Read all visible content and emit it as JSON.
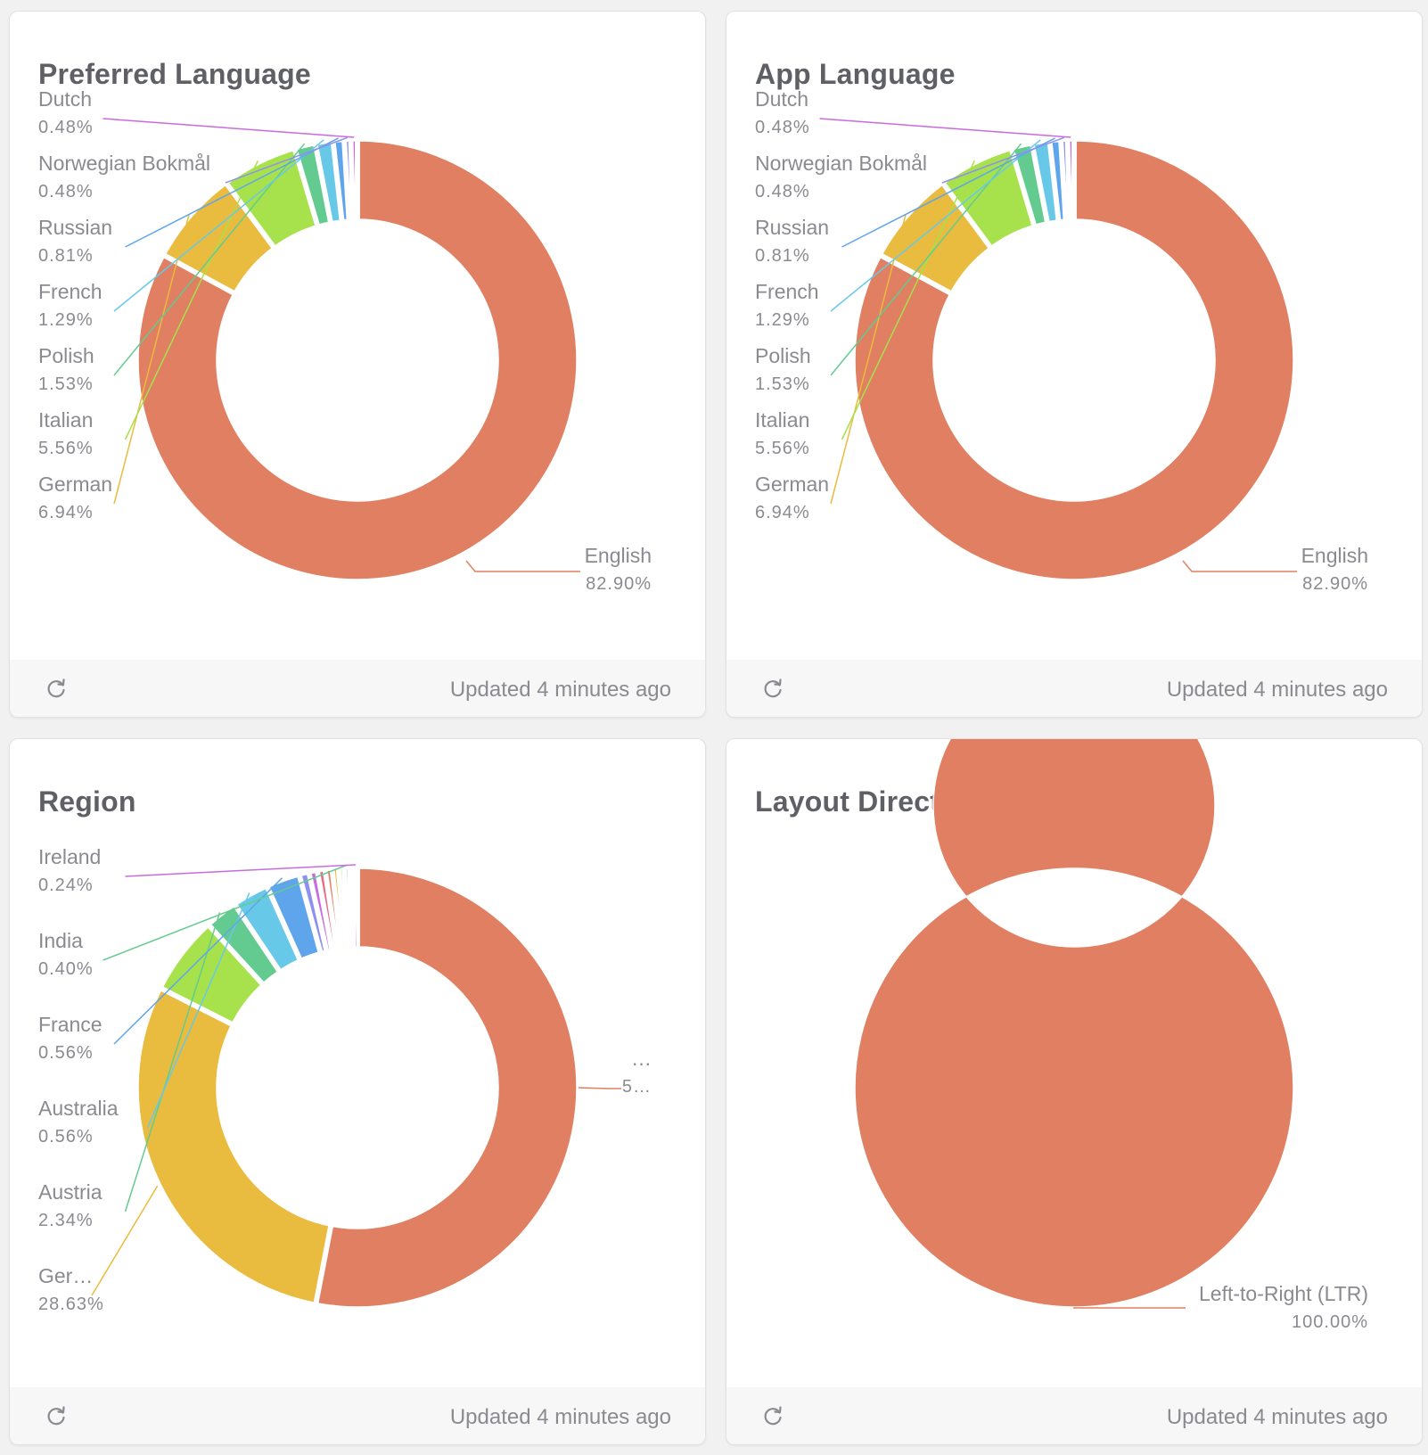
{
  "cards": [
    {
      "title": "Preferred Language",
      "updated": "Updated 4 minutes ago",
      "refresh_icon": "refresh-icon"
    },
    {
      "title": "App Language",
      "updated": "Updated 4 minutes ago",
      "refresh_icon": "refresh-icon"
    },
    {
      "title": "Region",
      "updated": "Updated 4 minutes ago",
      "refresh_icon": "refresh-icon"
    },
    {
      "title": "Layout Direction",
      "updated": "Updated 4 minutes ago",
      "refresh_icon": "refresh-icon"
    }
  ],
  "chart_data": [
    {
      "type": "pie",
      "donut": true,
      "title": "Preferred Language",
      "slices": [
        {
          "label": "English",
          "value_text": "82.90%",
          "value": 82.9,
          "color": "#e07f61"
        },
        {
          "label": "German",
          "value_text": "6.94%",
          "value": 6.94,
          "color": "#e9bb3e"
        },
        {
          "label": "Italian",
          "value_text": "5.56%",
          "value": 5.56,
          "color": "#a7e14c"
        },
        {
          "label": "Polish",
          "value_text": "1.53%",
          "value": 1.53,
          "color": "#64cb90"
        },
        {
          "label": "French",
          "value_text": "1.29%",
          "value": 1.29,
          "color": "#67c9e7"
        },
        {
          "label": "Russian",
          "value_text": "0.81%",
          "value": 0.81,
          "color": "#5fa5eb"
        },
        {
          "label": "Norwegian Bokmål",
          "value_text": "0.48%",
          "value": 0.48,
          "color": "#8f8ff0"
        },
        {
          "label": "Dutch",
          "value_text": "0.48%",
          "value": 0.48,
          "color": "#c86be0"
        }
      ]
    },
    {
      "type": "pie",
      "donut": true,
      "title": "App Language",
      "slices": [
        {
          "label": "English",
          "value_text": "82.90%",
          "value": 82.9,
          "color": "#e07f61"
        },
        {
          "label": "German",
          "value_text": "6.94%",
          "value": 6.94,
          "color": "#e9bb3e"
        },
        {
          "label": "Italian",
          "value_text": "5.56%",
          "value": 5.56,
          "color": "#a7e14c"
        },
        {
          "label": "Polish",
          "value_text": "1.53%",
          "value": 1.53,
          "color": "#64cb90"
        },
        {
          "label": "French",
          "value_text": "1.29%",
          "value": 1.29,
          "color": "#67c9e7"
        },
        {
          "label": "Russian",
          "value_text": "0.81%",
          "value": 0.81,
          "color": "#5fa5eb"
        },
        {
          "label": "Norwegian Bokmål",
          "value_text": "0.48%",
          "value": 0.48,
          "color": "#8f8ff0"
        },
        {
          "label": "Dutch",
          "value_text": "0.48%",
          "value": 0.48,
          "color": "#c86be0"
        }
      ]
    },
    {
      "type": "pie",
      "donut": true,
      "title": "Region",
      "slices": [
        {
          "label": "…",
          "value_text": "5…",
          "value": 51.6,
          "color": "#e07f61"
        },
        {
          "label": "Ger…",
          "value_text": "28.63%",
          "value": 28.63,
          "color": "#e9bb3e"
        },
        {
          "label": "",
          "value_text": "",
          "value": 5.6,
          "color": "#a7e14c"
        },
        {
          "label": "Austria",
          "value_text": "2.34%",
          "value": 2.34,
          "color": "#64cb90"
        },
        {
          "label": "Australia",
          "value_text": "0.56%",
          "value": 2.6,
          "color": "#67c9e7"
        },
        {
          "label": "France",
          "value_text": "0.56%",
          "value": 2.4,
          "color": "#5fa5eb"
        },
        {
          "label": "",
          "value_text": "",
          "value": 0.7,
          "color": "#8f8ff0"
        },
        {
          "label": "",
          "value_text": "",
          "value": 0.6,
          "color": "#c86be0"
        },
        {
          "label": "",
          "value_text": "",
          "value": 0.55,
          "color": "#e56b86"
        },
        {
          "label": "",
          "value_text": "",
          "value": 0.5,
          "color": "#e07f61"
        },
        {
          "label": "",
          "value_text": "",
          "value": 0.45,
          "color": "#e9bb3e"
        },
        {
          "label": "",
          "value_text": "",
          "value": 0.4,
          "color": "#a7e14c"
        },
        {
          "label": "India",
          "value_text": "0.40%",
          "value": 0.4,
          "color": "#64cb90"
        },
        {
          "label": "",
          "value_text": "",
          "value": 0.3,
          "color": "#67c9e7"
        },
        {
          "label": "Ireland",
          "value_text": "0.24%",
          "value": 0.24,
          "color": "#c86be0"
        }
      ]
    },
    {
      "type": "pie",
      "donut": true,
      "title": "Layout Direction",
      "slices": [
        {
          "label": "Left-to-Right (LTR)",
          "value_text": "100.00%",
          "value": 100.0,
          "color": "#e07f61"
        }
      ]
    }
  ]
}
